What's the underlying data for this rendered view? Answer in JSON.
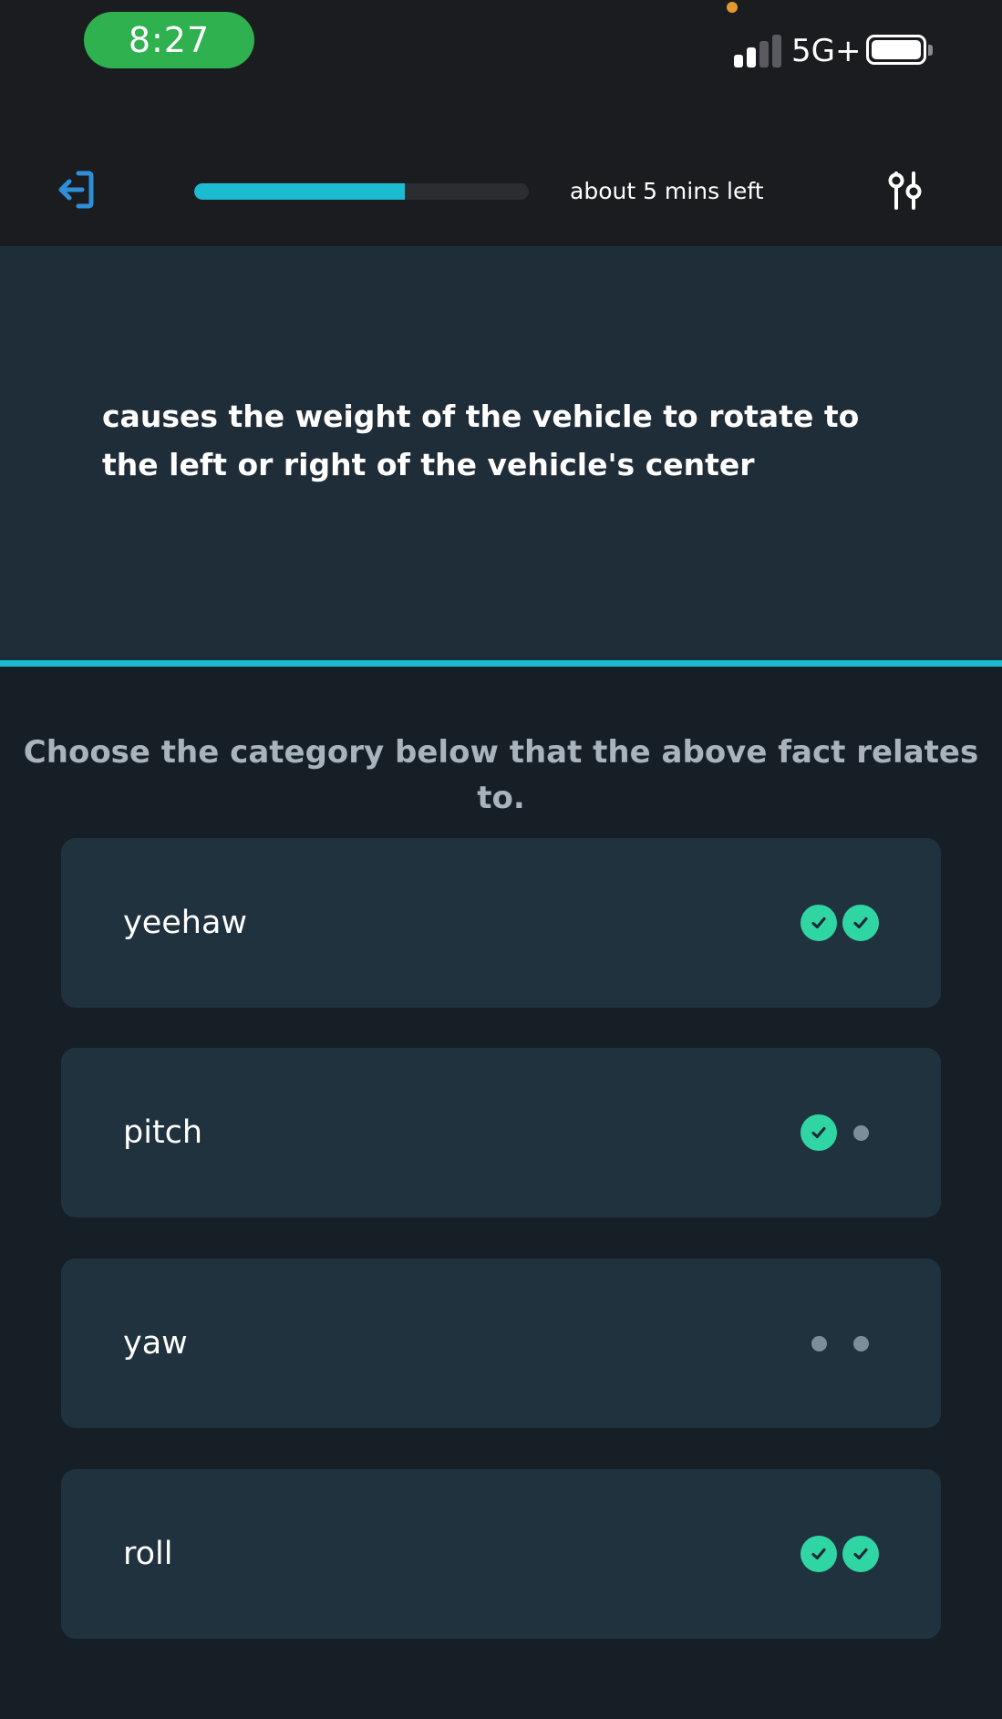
{
  "status_bar": {
    "time": "8:27",
    "network": "5G+",
    "icons": [
      "signal-icon",
      "battery-icon",
      "privacy-indicator"
    ]
  },
  "header": {
    "back_icon": "exit-icon",
    "progress": 0.63,
    "time_left": "about 5 mins left",
    "settings_icon": "sliders-icon"
  },
  "fact": {
    "text": "causes the weight of the vehicle to rotate to the left or right of the vehicle's center"
  },
  "prompt": "Choose the category below that the above fact relates to.",
  "options": [
    {
      "label": "yeehaw",
      "marks": [
        "check",
        "check"
      ]
    },
    {
      "label": "pitch",
      "marks": [
        "check",
        "dot"
      ]
    },
    {
      "label": "yaw",
      "marks": [
        "dot",
        "dot"
      ]
    },
    {
      "label": "roll",
      "marks": [
        "check",
        "check"
      ]
    }
  ],
  "colors": {
    "accent": "#1bbbd1",
    "check": "#2fd6a4",
    "dot": "#7d8e99",
    "card": "#21323f"
  }
}
